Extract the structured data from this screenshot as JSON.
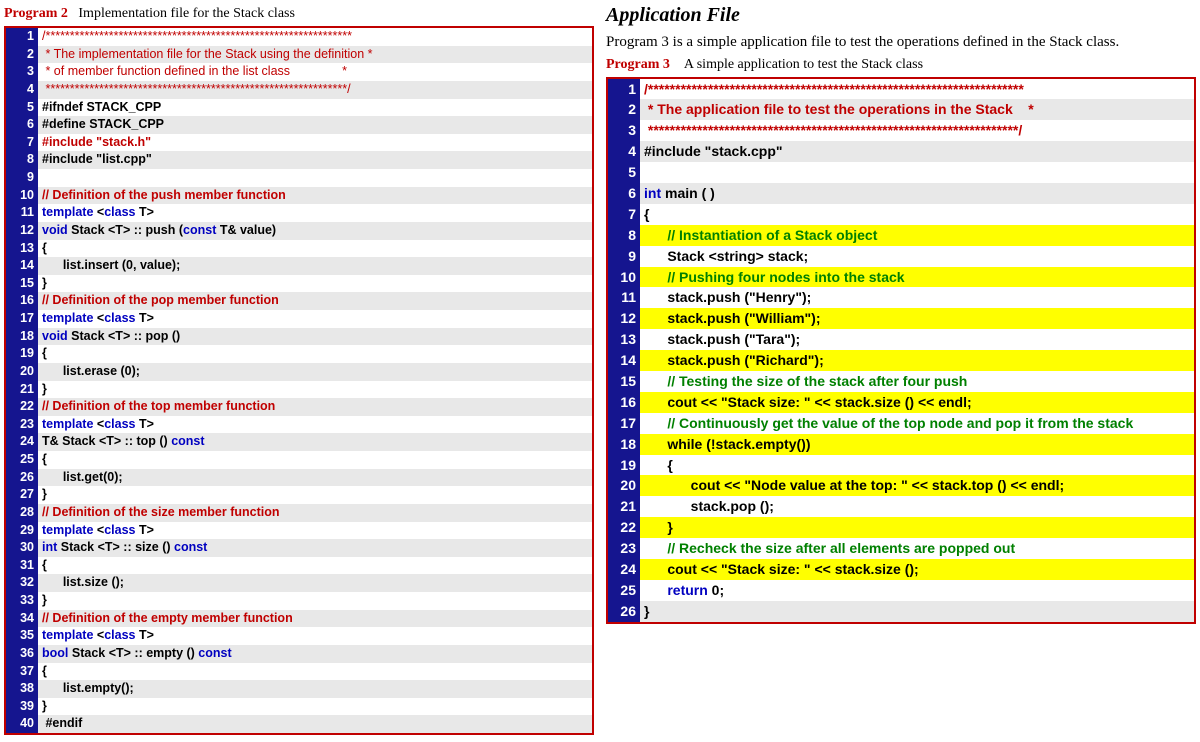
{
  "left": {
    "title_label": "Program 2",
    "title_text": "Implementation file for the Stack class",
    "lines": [
      {
        "n": 1,
        "hl": false,
        "alt": false,
        "spans": [
          {
            "cls": "c-red",
            "t": "/***************************************************************"
          }
        ]
      },
      {
        "n": 2,
        "hl": false,
        "alt": true,
        "spans": [
          {
            "cls": "c-red",
            "t": " * The implementation file for the Stack using the definition *"
          }
        ]
      },
      {
        "n": 3,
        "hl": false,
        "alt": false,
        "spans": [
          {
            "cls": "c-red",
            "t": " * of member function defined in the list class               *"
          }
        ]
      },
      {
        "n": 4,
        "hl": false,
        "alt": true,
        "spans": [
          {
            "cls": "c-red",
            "t": " **************************************************************/"
          }
        ]
      },
      {
        "n": 5,
        "hl": false,
        "alt": false,
        "spans": [
          {
            "cls": "bold",
            "t": "#ifndef STACK_CPP"
          }
        ]
      },
      {
        "n": 6,
        "hl": false,
        "alt": true,
        "spans": [
          {
            "cls": "bold",
            "t": "#define STACK_CPP"
          }
        ]
      },
      {
        "n": 7,
        "hl": false,
        "alt": false,
        "spans": [
          {
            "cls": "c-red bold",
            "t": "#include \"stack.h\""
          }
        ]
      },
      {
        "n": 8,
        "hl": false,
        "alt": true,
        "spans": [
          {
            "cls": "bold",
            "t": "#include \"list.cpp\""
          }
        ]
      },
      {
        "n": 9,
        "hl": false,
        "alt": false,
        "spans": [
          {
            "cls": "",
            "t": " "
          }
        ]
      },
      {
        "n": 10,
        "hl": false,
        "alt": true,
        "spans": [
          {
            "cls": "c-red bold",
            "t": "// Definition of the push member function"
          }
        ]
      },
      {
        "n": 11,
        "hl": false,
        "alt": false,
        "spans": [
          {
            "cls": "c-kw bold",
            "t": "template "
          },
          {
            "cls": "bold",
            "t": "<"
          },
          {
            "cls": "c-kw bold",
            "t": "class"
          },
          {
            "cls": "bold",
            "t": " T>"
          }
        ]
      },
      {
        "n": 12,
        "hl": false,
        "alt": true,
        "spans": [
          {
            "cls": "c-kw bold",
            "t": "void"
          },
          {
            "cls": "bold",
            "t": " Stack <T> :: push ("
          },
          {
            "cls": "c-kw bold",
            "t": "const"
          },
          {
            "cls": "bold",
            "t": " T& value)"
          }
        ]
      },
      {
        "n": 13,
        "hl": false,
        "alt": false,
        "spans": [
          {
            "cls": "bold",
            "t": "{"
          }
        ]
      },
      {
        "n": 14,
        "hl": false,
        "alt": true,
        "spans": [
          {
            "cls": "bold",
            "t": "      list.insert (0, value);"
          }
        ]
      },
      {
        "n": 15,
        "hl": false,
        "alt": false,
        "spans": [
          {
            "cls": "bold",
            "t": "}"
          }
        ]
      },
      {
        "n": 16,
        "hl": false,
        "alt": true,
        "spans": [
          {
            "cls": "c-red bold",
            "t": "// Definition of the pop member function"
          }
        ]
      },
      {
        "n": 17,
        "hl": false,
        "alt": false,
        "spans": [
          {
            "cls": "c-kw bold",
            "t": "template "
          },
          {
            "cls": "bold",
            "t": "<"
          },
          {
            "cls": "c-kw bold",
            "t": "class"
          },
          {
            "cls": "bold",
            "t": " T>"
          }
        ]
      },
      {
        "n": 18,
        "hl": false,
        "alt": true,
        "spans": [
          {
            "cls": "c-kw bold",
            "t": "void"
          },
          {
            "cls": "bold",
            "t": " Stack <T> :: pop ()"
          }
        ]
      },
      {
        "n": 19,
        "hl": false,
        "alt": false,
        "spans": [
          {
            "cls": "bold",
            "t": "{"
          }
        ]
      },
      {
        "n": 20,
        "hl": false,
        "alt": true,
        "spans": [
          {
            "cls": "bold",
            "t": "      list.erase (0);"
          }
        ]
      },
      {
        "n": 21,
        "hl": false,
        "alt": false,
        "spans": [
          {
            "cls": "bold",
            "t": "}"
          }
        ]
      },
      {
        "n": 22,
        "hl": false,
        "alt": true,
        "spans": [
          {
            "cls": "c-red bold",
            "t": "// Definition of the top member function"
          }
        ]
      },
      {
        "n": 23,
        "hl": false,
        "alt": false,
        "spans": [
          {
            "cls": "c-kw bold",
            "t": "template "
          },
          {
            "cls": "bold",
            "t": "<"
          },
          {
            "cls": "c-kw bold",
            "t": "class"
          },
          {
            "cls": "bold",
            "t": " T>"
          }
        ]
      },
      {
        "n": 24,
        "hl": false,
        "alt": true,
        "spans": [
          {
            "cls": "bold",
            "t": "T& Stack <T> :: top () "
          },
          {
            "cls": "c-kw bold",
            "t": "const"
          }
        ]
      },
      {
        "n": 25,
        "hl": false,
        "alt": false,
        "spans": [
          {
            "cls": "bold",
            "t": "{"
          }
        ]
      },
      {
        "n": 26,
        "hl": false,
        "alt": true,
        "spans": [
          {
            "cls": "bold",
            "t": "      list.get(0);"
          }
        ]
      },
      {
        "n": 27,
        "hl": false,
        "alt": false,
        "spans": [
          {
            "cls": "bold",
            "t": "}"
          }
        ]
      },
      {
        "n": 28,
        "hl": false,
        "alt": true,
        "spans": [
          {
            "cls": "c-red bold",
            "t": "// Definition of the size member function"
          }
        ]
      },
      {
        "n": 29,
        "hl": false,
        "alt": false,
        "spans": [
          {
            "cls": "c-kw bold",
            "t": "template "
          },
          {
            "cls": "bold",
            "t": "<"
          },
          {
            "cls": "c-kw bold",
            "t": "class"
          },
          {
            "cls": "bold",
            "t": " T>"
          }
        ]
      },
      {
        "n": 30,
        "hl": false,
        "alt": true,
        "spans": [
          {
            "cls": "c-kw bold",
            "t": "int"
          },
          {
            "cls": "bold",
            "t": " Stack <T> :: size () "
          },
          {
            "cls": "c-kw bold",
            "t": "const"
          }
        ]
      },
      {
        "n": 31,
        "hl": false,
        "alt": false,
        "spans": [
          {
            "cls": "bold",
            "t": "{"
          }
        ]
      },
      {
        "n": 32,
        "hl": false,
        "alt": true,
        "spans": [
          {
            "cls": "bold",
            "t": "      list.size ();"
          }
        ]
      },
      {
        "n": 33,
        "hl": false,
        "alt": false,
        "spans": [
          {
            "cls": "bold",
            "t": "}"
          }
        ]
      },
      {
        "n": 34,
        "hl": false,
        "alt": true,
        "spans": [
          {
            "cls": "c-red bold",
            "t": "// Definition of the empty member function"
          }
        ]
      },
      {
        "n": 35,
        "hl": false,
        "alt": false,
        "spans": [
          {
            "cls": "c-kw bold",
            "t": "template "
          },
          {
            "cls": "bold",
            "t": "<"
          },
          {
            "cls": "c-kw bold",
            "t": "class"
          },
          {
            "cls": "bold",
            "t": " T>"
          }
        ]
      },
      {
        "n": 36,
        "hl": false,
        "alt": true,
        "spans": [
          {
            "cls": "c-kw bold",
            "t": "bool"
          },
          {
            "cls": "bold",
            "t": " Stack <T> :: empty () "
          },
          {
            "cls": "c-kw bold",
            "t": "const"
          }
        ]
      },
      {
        "n": 37,
        "hl": false,
        "alt": false,
        "spans": [
          {
            "cls": "bold",
            "t": "{"
          }
        ]
      },
      {
        "n": 38,
        "hl": false,
        "alt": true,
        "spans": [
          {
            "cls": "bold",
            "t": "      list.empty();"
          }
        ]
      },
      {
        "n": 39,
        "hl": false,
        "alt": false,
        "spans": [
          {
            "cls": "bold",
            "t": "}"
          }
        ]
      },
      {
        "n": 40,
        "hl": false,
        "alt": true,
        "spans": [
          {
            "cls": "bold",
            "t": " #endif"
          }
        ]
      }
    ]
  },
  "right": {
    "app_title": "Application File",
    "desc": "Program 3 is a simple application file to test the operations defined in the Stack class.",
    "title_label": "Program 3",
    "title_text": "A simple application to test the Stack class",
    "lines": [
      {
        "n": 1,
        "hl": false,
        "alt": false,
        "spans": [
          {
            "cls": "c-red bold",
            "t": "/*********************************************************************"
          }
        ]
      },
      {
        "n": 2,
        "hl": false,
        "alt": true,
        "spans": [
          {
            "cls": "c-red bold",
            "t": " * The application file to test the operations in the Stack    *"
          }
        ]
      },
      {
        "n": 3,
        "hl": false,
        "alt": false,
        "spans": [
          {
            "cls": "c-red bold",
            "t": " ********************************************************************/"
          }
        ]
      },
      {
        "n": 4,
        "hl": false,
        "alt": true,
        "spans": [
          {
            "cls": "bold",
            "t": "#include \"stack.cpp\""
          }
        ]
      },
      {
        "n": 5,
        "hl": false,
        "alt": false,
        "spans": [
          {
            "cls": "",
            "t": " "
          }
        ]
      },
      {
        "n": 6,
        "hl": false,
        "alt": true,
        "spans": [
          {
            "cls": "c-kw bold",
            "t": "int"
          },
          {
            "cls": "bold",
            "t": " main ( )"
          }
        ]
      },
      {
        "n": 7,
        "hl": false,
        "alt": false,
        "spans": [
          {
            "cls": "bold",
            "t": "{"
          }
        ]
      },
      {
        "n": 8,
        "hl": true,
        "alt": false,
        "spans": [
          {
            "cls": "c-comment bold",
            "t": "      // Instantiation of a Stack object"
          }
        ]
      },
      {
        "n": 9,
        "hl": false,
        "alt": false,
        "spans": [
          {
            "cls": "bold",
            "t": "      Stack <string> stack;"
          }
        ]
      },
      {
        "n": 10,
        "hl": true,
        "alt": false,
        "spans": [
          {
            "cls": "c-comment bold",
            "t": "      // Pushing four nodes into the stack"
          }
        ]
      },
      {
        "n": 11,
        "hl": false,
        "alt": false,
        "spans": [
          {
            "cls": "bold",
            "t": "      stack.push (\"Henry\");"
          }
        ]
      },
      {
        "n": 12,
        "hl": true,
        "alt": false,
        "spans": [
          {
            "cls": "bold",
            "t": "      stack.push (\"William\");"
          }
        ]
      },
      {
        "n": 13,
        "hl": false,
        "alt": false,
        "spans": [
          {
            "cls": "bold",
            "t": "      stack.push (\"Tara\");"
          }
        ]
      },
      {
        "n": 14,
        "hl": true,
        "alt": false,
        "spans": [
          {
            "cls": "bold",
            "t": "      stack.push (\"Richard\");"
          }
        ]
      },
      {
        "n": 15,
        "hl": false,
        "alt": false,
        "spans": [
          {
            "cls": "c-comment bold",
            "t": "      // Testing the size of the stack after four push"
          }
        ]
      },
      {
        "n": 16,
        "hl": true,
        "alt": false,
        "spans": [
          {
            "cls": "bold",
            "t": "      cout << \"Stack size: \" << stack.size () << endl;"
          }
        ]
      },
      {
        "n": 17,
        "hl": false,
        "alt": false,
        "spans": [
          {
            "cls": "c-comment bold",
            "t": "      // Continuously get the value of the top node and pop it from the stack"
          }
        ]
      },
      {
        "n": 18,
        "hl": true,
        "alt": false,
        "spans": [
          {
            "cls": "bold",
            "t": "      while (!stack.empty())"
          }
        ]
      },
      {
        "n": 19,
        "hl": false,
        "alt": false,
        "spans": [
          {
            "cls": "bold",
            "t": "      {"
          }
        ]
      },
      {
        "n": 20,
        "hl": true,
        "alt": false,
        "spans": [
          {
            "cls": "bold",
            "t": "            cout << \"Node value at the top: \" << stack.top () << endl;"
          }
        ]
      },
      {
        "n": 21,
        "hl": false,
        "alt": false,
        "spans": [
          {
            "cls": "bold",
            "t": "            stack.pop ();"
          }
        ]
      },
      {
        "n": 22,
        "hl": true,
        "alt": false,
        "spans": [
          {
            "cls": "bold",
            "t": "      }"
          }
        ]
      },
      {
        "n": 23,
        "hl": false,
        "alt": false,
        "spans": [
          {
            "cls": "c-comment bold",
            "t": "      // Recheck the size after all elements are popped out"
          }
        ]
      },
      {
        "n": 24,
        "hl": true,
        "alt": false,
        "spans": [
          {
            "cls": "bold",
            "t": "      cout << \"Stack size: \" << stack.size ();"
          }
        ]
      },
      {
        "n": 25,
        "hl": false,
        "alt": false,
        "spans": [
          {
            "cls": "c-kw bold",
            "t": "      return"
          },
          {
            "cls": "bold",
            "t": " 0;"
          }
        ]
      },
      {
        "n": 26,
        "hl": false,
        "alt": true,
        "spans": [
          {
            "cls": "bold",
            "t": "}"
          }
        ]
      }
    ]
  }
}
